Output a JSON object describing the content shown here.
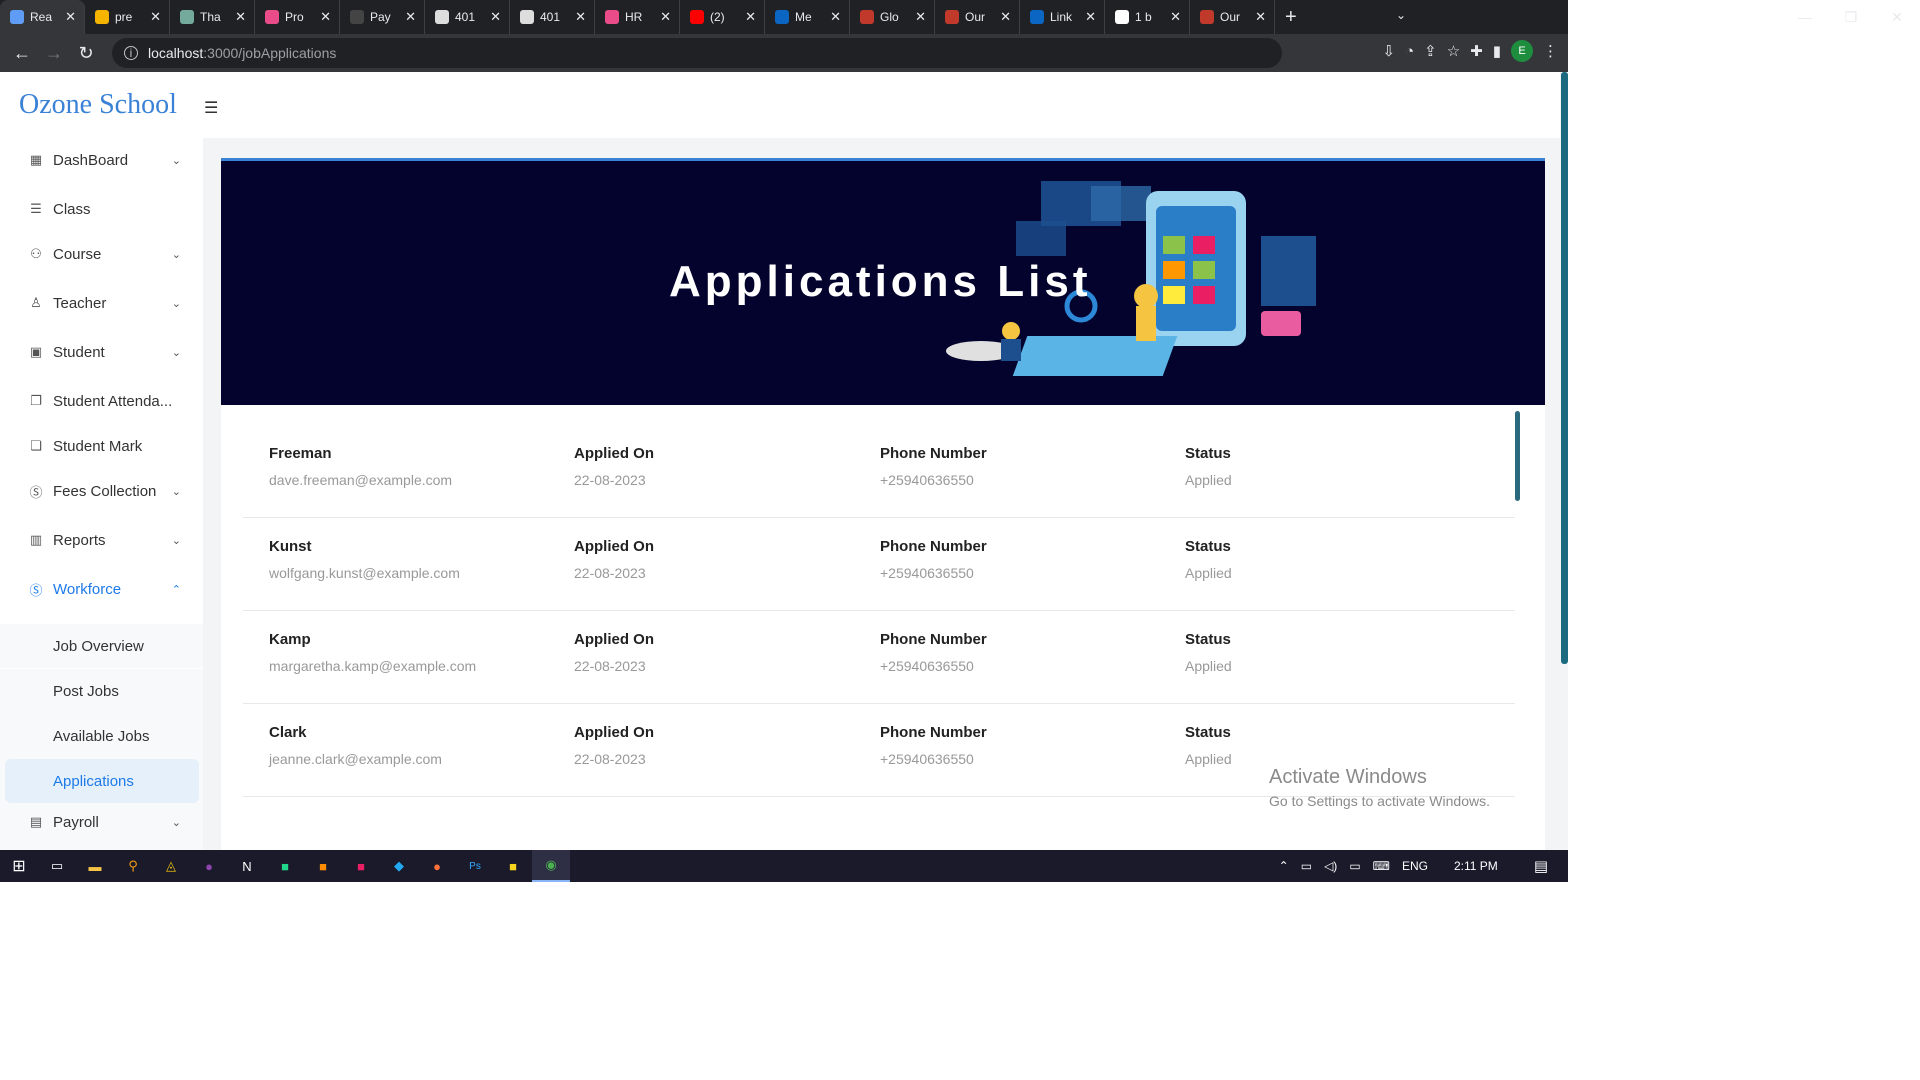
{
  "browser": {
    "tabs": [
      {
        "title": "Rea",
        "color": "#5f9cf5",
        "active": true
      },
      {
        "title": "pre",
        "color": "#f4b400"
      },
      {
        "title": "Tha",
        "color": "#74aa9c"
      },
      {
        "title": "Pro",
        "color": "#ea4c89"
      },
      {
        "title": "Pay",
        "color": "#444444"
      },
      {
        "title": "401",
        "color": "#dddddd"
      },
      {
        "title": "401",
        "color": "#dddddd"
      },
      {
        "title": "HR",
        "color": "#ea4c89"
      },
      {
        "title": "(2) ",
        "color": "#ff0000"
      },
      {
        "title": "Me",
        "color": "#0a66c2"
      },
      {
        "title": "Glo",
        "color": "#c0392b"
      },
      {
        "title": "Our",
        "color": "#c0392b"
      },
      {
        "title": "Link",
        "color": "#0a66c2"
      },
      {
        "title": "1 b",
        "color": "#ffffff"
      },
      {
        "title": "Our",
        "color": "#c0392b"
      }
    ],
    "url_host": "localhost",
    "url_path": ":3000/jobApplications",
    "profile_initial": "E"
  },
  "app": {
    "logo": "Ozone School",
    "sidebar": [
      {
        "label": "DashBoard",
        "icon": "dashboard-icon",
        "glyph": "▦",
        "chevron": "⌄"
      },
      {
        "label": "Class",
        "icon": "class-icon",
        "glyph": "☰",
        "chevron": ""
      },
      {
        "label": "Course",
        "icon": "course-icon",
        "glyph": "⚇",
        "chevron": "⌄"
      },
      {
        "label": "Teacher",
        "icon": "teacher-icon",
        "glyph": "♙",
        "chevron": "⌄"
      },
      {
        "label": "Student",
        "icon": "student-icon",
        "glyph": "▣",
        "chevron": "⌄"
      },
      {
        "label": "Student Attenda...",
        "icon": "attendance-icon",
        "glyph": "❐",
        "chevron": ""
      },
      {
        "label": "Student Mark",
        "icon": "mark-icon",
        "glyph": "❏",
        "chevron": ""
      },
      {
        "label": "Fees Collection",
        "icon": "fees-icon",
        "glyph": "Ⓢ",
        "chevron": "⌄"
      },
      {
        "label": "Reports",
        "icon": "reports-icon",
        "glyph": "▥",
        "chevron": "⌄"
      },
      {
        "label": "Workforce",
        "icon": "workforce-icon",
        "glyph": "Ⓢ",
        "chevron": "⌃"
      },
      {
        "label": "Payroll",
        "icon": "payroll-icon",
        "glyph": "▤",
        "chevron": "⌄"
      }
    ],
    "workforce_sub": [
      "Job Overview",
      "Post Jobs",
      "Available Jobs",
      "Applications"
    ],
    "banner_title": "Applications List",
    "columns": {
      "applied": "Applied On",
      "phone": "Phone Number",
      "status": "Status"
    },
    "applications": [
      {
        "name": "Freeman",
        "email": "dave.freeman@example.com",
        "applied_on": "22-08-2023",
        "phone": "+25940636550",
        "status": "Applied"
      },
      {
        "name": "Kunst",
        "email": "wolfgang.kunst@example.com",
        "applied_on": "22-08-2023",
        "phone": "+25940636550",
        "status": "Applied"
      },
      {
        "name": "Kamp",
        "email": "margaretha.kamp@example.com",
        "applied_on": "22-08-2023",
        "phone": "+25940636550",
        "status": "Applied"
      },
      {
        "name": "Clark",
        "email": "jeanne.clark@example.com",
        "applied_on": "22-08-2023",
        "phone": "+25940636550",
        "status": "Applied"
      }
    ]
  },
  "watermark": {
    "line1": "Activate Windows",
    "line2": "Go to Settings to activate Windows."
  },
  "taskbar": {
    "lang": "ENG",
    "time": "2:11 PM"
  }
}
